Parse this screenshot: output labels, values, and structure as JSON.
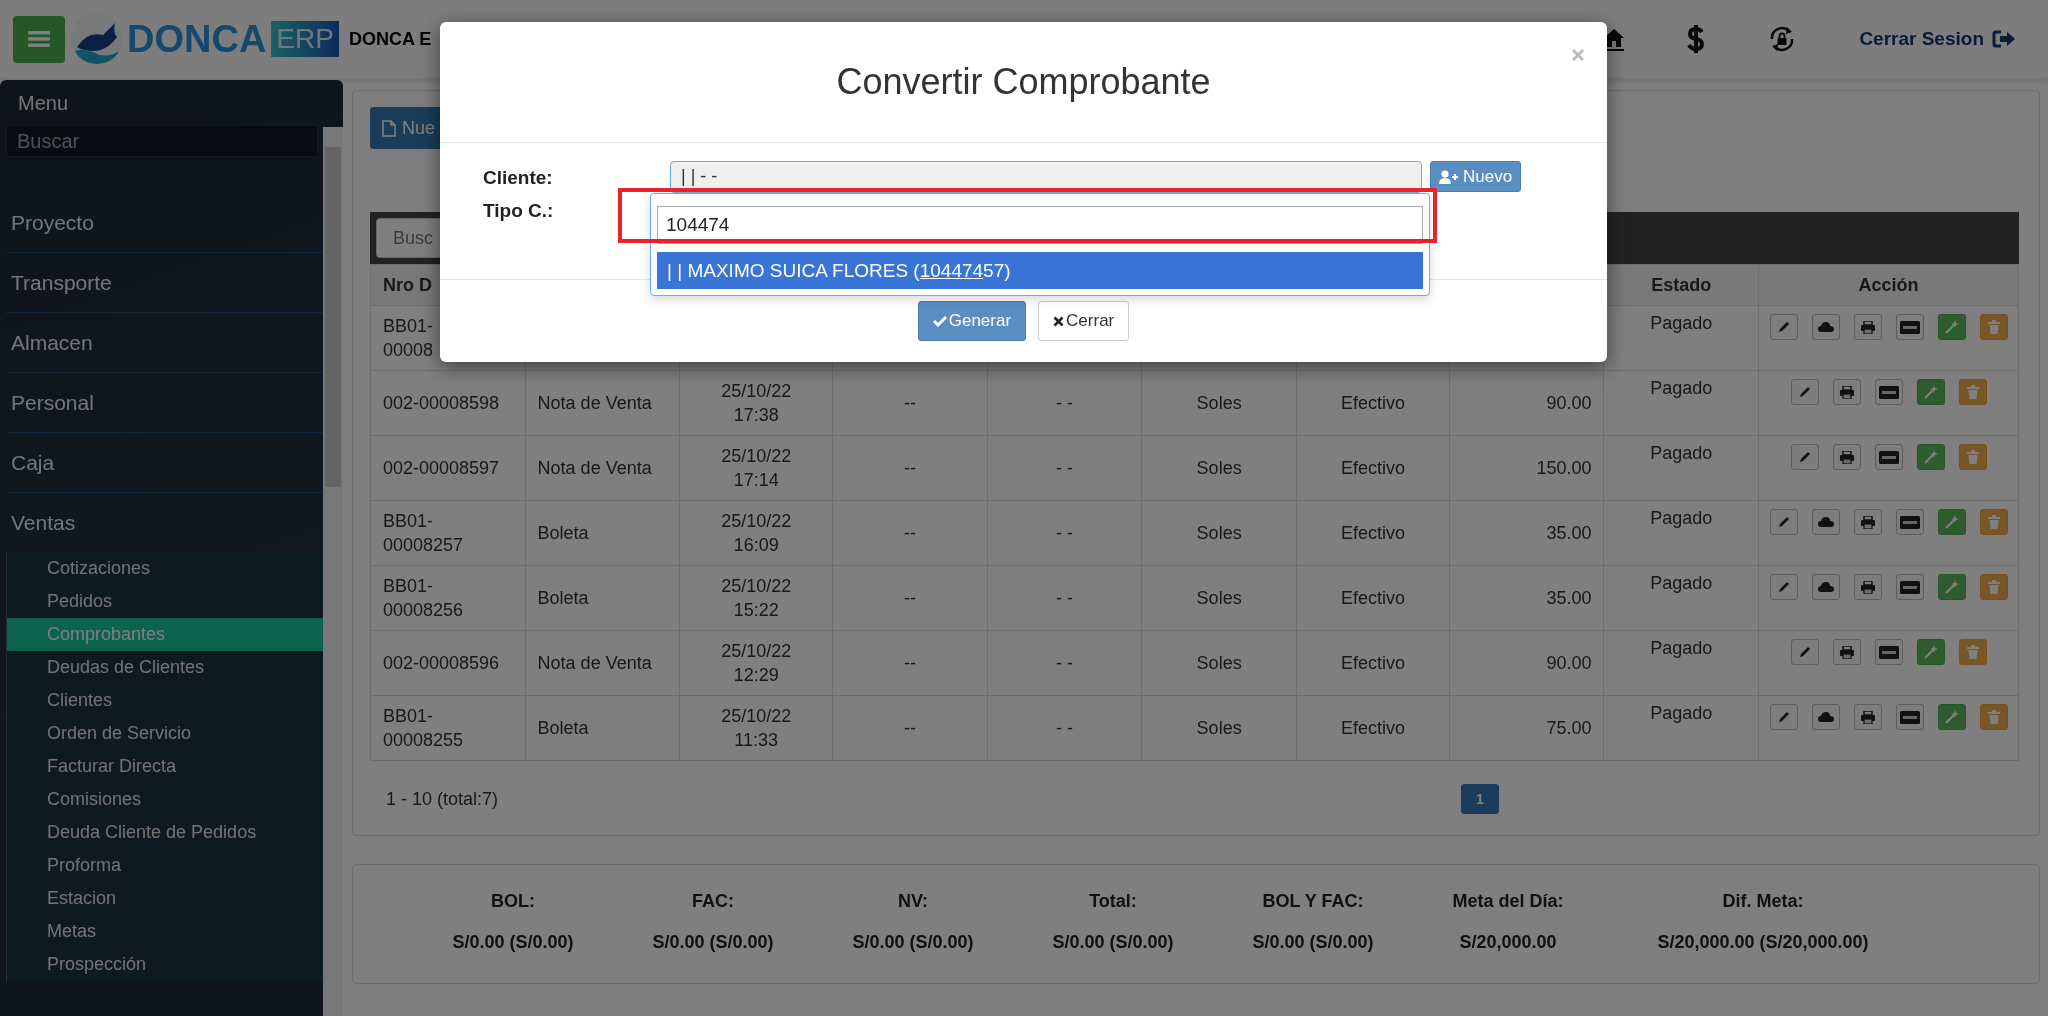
{
  "header": {
    "logo": {
      "wordmark": "DONCA",
      "badge": "ERP"
    },
    "company": "DONCA E",
    "logout": "Cerrar Sesion"
  },
  "sidebar": {
    "title": "Menu",
    "search_placeholder": "Buscar",
    "items": [
      {
        "label": "Proyecto",
        "expanded": false
      },
      {
        "label": "Transporte",
        "expanded": false
      },
      {
        "label": "Almacen",
        "expanded": false
      },
      {
        "label": "Personal",
        "expanded": false
      },
      {
        "label": "Caja",
        "expanded": false
      },
      {
        "label": "Ventas",
        "expanded": true,
        "children": [
          {
            "label": "Cotizaciones",
            "selected": false
          },
          {
            "label": "Pedidos",
            "selected": false
          },
          {
            "label": "Comprobantes",
            "selected": true
          },
          {
            "label": "Deudas de Clientes",
            "selected": false
          },
          {
            "label": "Clientes",
            "selected": false
          },
          {
            "label": "Orden de Servicio",
            "selected": false
          },
          {
            "label": "Facturar Directa",
            "selected": false
          },
          {
            "label": "Comisiones",
            "selected": false
          },
          {
            "label": "Deuda Cliente de Pedidos",
            "selected": false
          },
          {
            "label": "Proforma",
            "selected": false
          },
          {
            "label": "Estacion",
            "selected": false
          },
          {
            "label": "Metas",
            "selected": false
          },
          {
            "label": "Prospección",
            "selected": false
          }
        ]
      }
    ]
  },
  "toolbar": {
    "new_button": "Nue"
  },
  "table": {
    "search_placeholder": "Busc",
    "header": {
      "nro": "Nro D",
      "estado": "Estado",
      "accion": "Acción"
    },
    "rows": [
      {
        "nro": "BB01-\n00008",
        "estado": "Pagado",
        "actions": [
          {
            "kind": "edit"
          },
          {
            "kind": "cloud"
          },
          {
            "kind": "print"
          },
          {
            "kind": "visa"
          },
          {
            "kind": "convert"
          },
          {
            "kind": "delete"
          }
        ]
      },
      {
        "nro": "002-00008598",
        "tipo": "Nota de Venta",
        "fecha": "25/10/22\n17:38",
        "column_4": "--",
        "column_5": "- -",
        "moneda": "Soles",
        "pago": "Efectivo",
        "total": "90.00",
        "estado": "Pagado",
        "actions": [
          {
            "kind": "edit"
          },
          {
            "kind": "print"
          },
          {
            "kind": "visa"
          },
          {
            "kind": "convert"
          },
          {
            "kind": "delete"
          }
        ]
      },
      {
        "nro": "002-00008597",
        "tipo": "Nota de Venta",
        "fecha": "25/10/22\n17:14",
        "column_4": "--",
        "column_5": "- -",
        "moneda": "Soles",
        "pago": "Efectivo",
        "total": "150.00",
        "estado": "Pagado",
        "actions": [
          {
            "kind": "edit"
          },
          {
            "kind": "print"
          },
          {
            "kind": "visa"
          },
          {
            "kind": "convert"
          },
          {
            "kind": "delete"
          }
        ]
      },
      {
        "nro": "BB01-\n00008257",
        "tipo": "Boleta",
        "fecha": "25/10/22\n16:09",
        "column_4": "--",
        "column_5": "- -",
        "moneda": "Soles",
        "pago": "Efectivo",
        "total": "35.00",
        "estado": "Pagado",
        "actions": [
          {
            "kind": "edit"
          },
          {
            "kind": "cloud"
          },
          {
            "kind": "print"
          },
          {
            "kind": "visa"
          },
          {
            "kind": "convert"
          },
          {
            "kind": "delete"
          }
        ]
      },
      {
        "nro": "BB01-\n00008256",
        "tipo": "Boleta",
        "fecha": "25/10/22\n15:22",
        "column_4": "--",
        "column_5": "- -",
        "moneda": "Soles",
        "pago": "Efectivo",
        "total": "35.00",
        "estado": "Pagado",
        "actions": [
          {
            "kind": "edit"
          },
          {
            "kind": "cloud"
          },
          {
            "kind": "print"
          },
          {
            "kind": "visa"
          },
          {
            "kind": "convert"
          },
          {
            "kind": "delete"
          }
        ]
      },
      {
        "nro": "002-00008596",
        "tipo": "Nota de Venta",
        "fecha": "25/10/22\n12:29",
        "column_4": "--",
        "column_5": "- -",
        "moneda": "Soles",
        "pago": "Efectivo",
        "total": "90.00",
        "estado": "Pagado",
        "actions": [
          {
            "kind": "edit"
          },
          {
            "kind": "print"
          },
          {
            "kind": "visa"
          },
          {
            "kind": "convert"
          },
          {
            "kind": "delete"
          }
        ]
      },
      {
        "nro": "BB01-\n00008255",
        "tipo": "Boleta",
        "fecha": "25/10/22\n11:33",
        "column_4": "--",
        "column_5": "- -",
        "moneda": "Soles",
        "pago": "Efectivo",
        "total": "75.00",
        "estado": "Pagado",
        "actions": [
          {
            "kind": "edit"
          },
          {
            "kind": "cloud"
          },
          {
            "kind": "print"
          },
          {
            "kind": "visa"
          },
          {
            "kind": "convert"
          },
          {
            "kind": "delete"
          }
        ]
      }
    ]
  },
  "pagination": {
    "summary": "1 - 10 (total:7)",
    "pages": [
      {
        "label": "1",
        "selected": true
      }
    ]
  },
  "summary": [
    {
      "label": "BOL:",
      "value": "S/0.00 (S/0.00)"
    },
    {
      "label": "FAC:",
      "value": "S/0.00 (S/0.00)"
    },
    {
      "label": "NV:",
      "value": "S/0.00 (S/0.00)"
    },
    {
      "label": "Total:",
      "value": "S/0.00 (S/0.00)"
    },
    {
      "label": "BOL Y FAC:",
      "value": "S/0.00 (S/0.00)"
    },
    {
      "label": "Meta del Día:",
      "value": "S/20,000.00"
    },
    {
      "label": "Dif. Meta:",
      "value": "S/20,000.00 (S/20,000.00)"
    }
  ],
  "modal": {
    "title": "Convertir Comprobante",
    "fields": [
      {
        "label": "Cliente:",
        "value": "| | - -"
      },
      {
        "label": "Tipo C.:"
      }
    ],
    "new_client_button": "Nuevo",
    "dropdown": {
      "query": "104474",
      "highlighted": true,
      "options": [
        {
          "before": "| | MAXIMO SUICA FLORES (",
          "match": "104474",
          "after": "57)",
          "selected": true
        }
      ]
    },
    "buttons": [
      {
        "label": "Generar",
        "kind": "primary"
      },
      {
        "label": "Cerrar",
        "kind": "default"
      }
    ]
  }
}
